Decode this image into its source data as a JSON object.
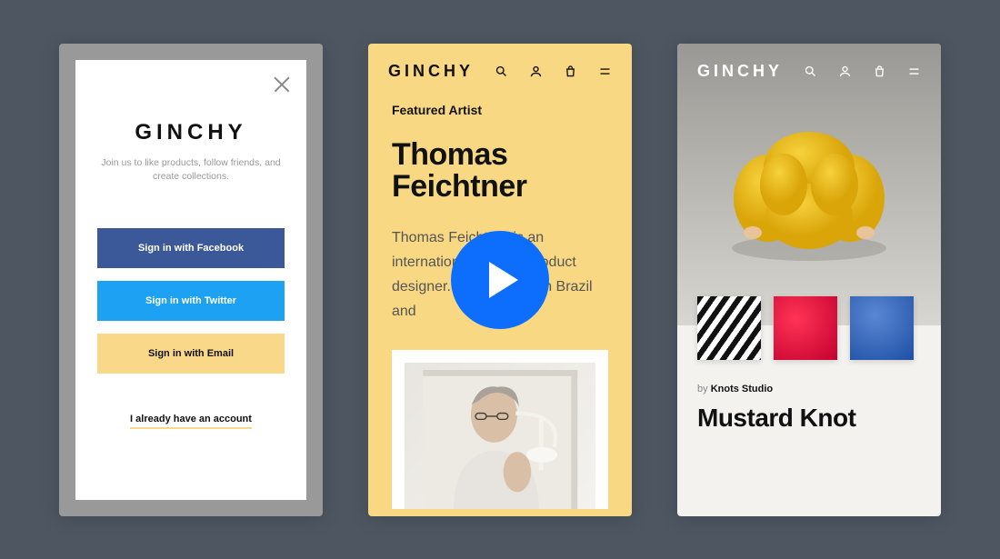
{
  "brand": "GINCHY",
  "screen1": {
    "tagline": "Join us to like products, follow friends, and create collections.",
    "facebook_label": "Sign in with Facebook",
    "twitter_label": "Sign in with Twitter",
    "email_label": "Sign in with Email",
    "already_label": "I already have an account"
  },
  "screen2": {
    "featured_label": "Featured Artist",
    "artist_name": "Thomas Feichtner",
    "bio": "Thomas Feichtner is an internationally active product designer. He was born in Brazil and"
  },
  "screen3": {
    "by_prefix": "by ",
    "studio": "Knots Studio",
    "product_title": "Mustard Knot"
  },
  "colors": {
    "bg": "#4d5661",
    "accent_yellow": "#f8d882",
    "facebook": "#3b5998",
    "twitter": "#1da1f2",
    "play_blue": "#0d6efd"
  }
}
